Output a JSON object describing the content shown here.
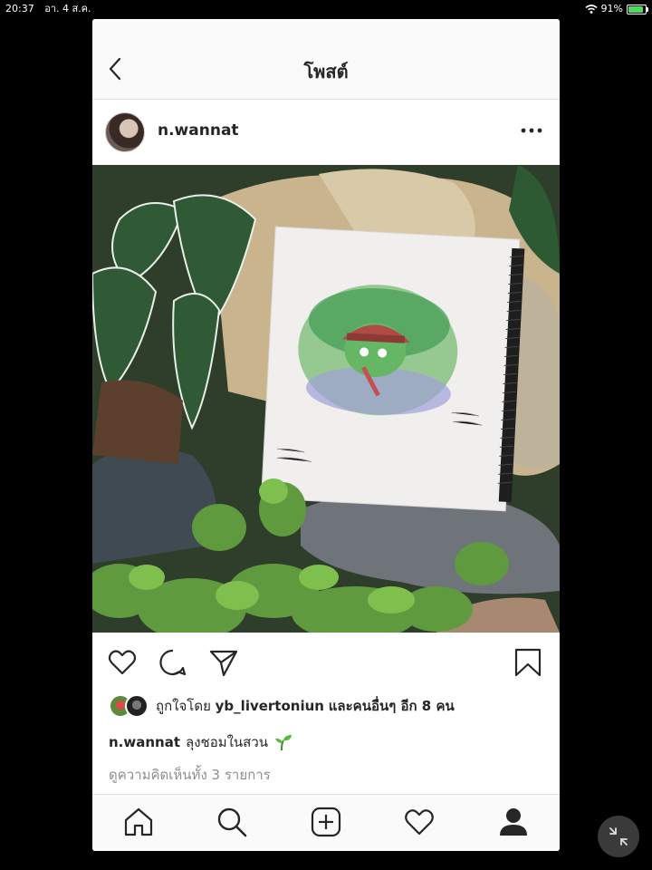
{
  "status_bar": {
    "time": "20:37",
    "date": "อา. 4 ส.ค.",
    "battery": "91%",
    "battery_level": 0.91
  },
  "nav": {
    "title": "โพสต์"
  },
  "post": {
    "username": "n.wannat",
    "likes": {
      "prefix": "ถูกใจโดย",
      "user": "yb_livertoniun",
      "suffix": "และคนอื่นๆ อีก 8 คน"
    },
    "caption": {
      "username": "n.wannat",
      "text": "ลุงชอมในสวน"
    },
    "comments_link": "ดูความคิดเห็นทั้ง 3 รายการ"
  },
  "icons": {
    "nav": [
      "back-icon",
      "more-icon"
    ],
    "actions": [
      "heart-icon",
      "comment-icon",
      "share-icon",
      "bookmark-icon"
    ],
    "tabs": [
      "home-icon",
      "search-icon",
      "add-icon",
      "activity-icon",
      "profile-icon"
    ],
    "floating": "collapse-icon"
  },
  "colors": {
    "text": "#262626",
    "muted": "#8e8e8e",
    "border": "#dbdbdb",
    "battery": "#4cd964"
  }
}
